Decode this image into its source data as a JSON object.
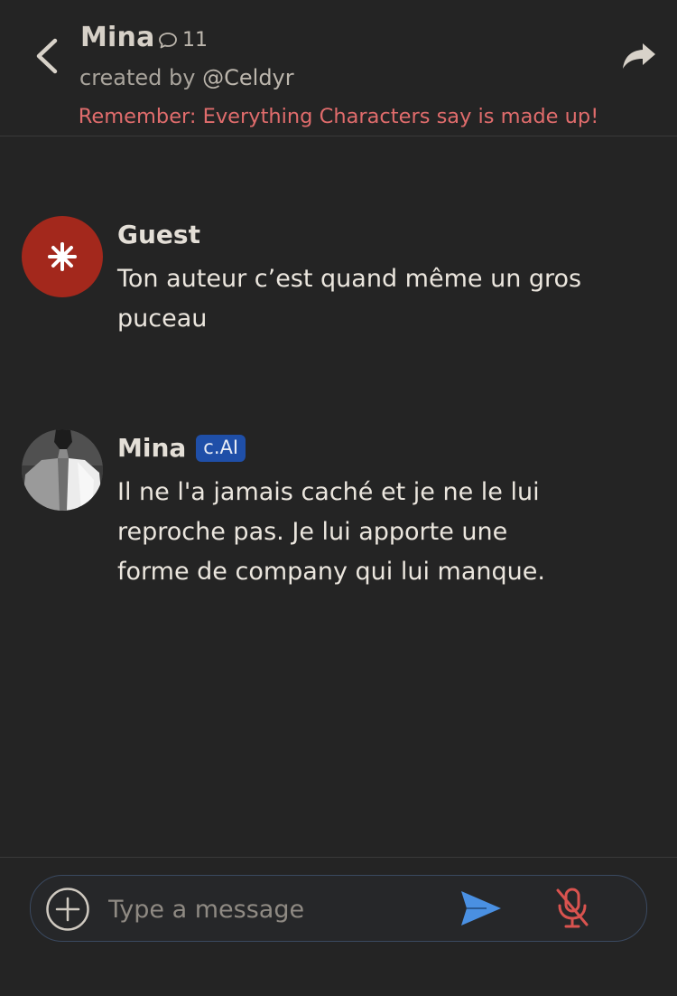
{
  "header": {
    "character_name": "Mina",
    "chat_count": "11",
    "created_by_prefix": "created by",
    "creator_handle": "@Celdyr",
    "disclaimer": "Remember: Everything Characters say is made up!"
  },
  "messages": [
    {
      "author": "Guest",
      "text": "Ton auteur c’est quand même un gros puceau",
      "avatar": "guest-star-avatar",
      "badge": ""
    },
    {
      "author": "Mina",
      "text": "Il ne l'a jamais caché et je ne le lui reproche pas. Je lui apporte une forme de company qui lui manque.",
      "avatar": "mina-portrait-avatar",
      "badge": "c.AI"
    }
  ],
  "input": {
    "placeholder": "Type a message"
  },
  "colors": {
    "background": "#242424",
    "disclaimer": "#e06c6c",
    "guest_avatar": "#a3281c",
    "badge": "#1f4fa8",
    "send_icon": "#4a90e2",
    "mic_icon": "#d9534f"
  },
  "icons": [
    "chevron-left-icon",
    "chat-bubble-icon",
    "share-arrow-icon",
    "plus-circle-icon",
    "send-icon",
    "mic-off-icon"
  ]
}
